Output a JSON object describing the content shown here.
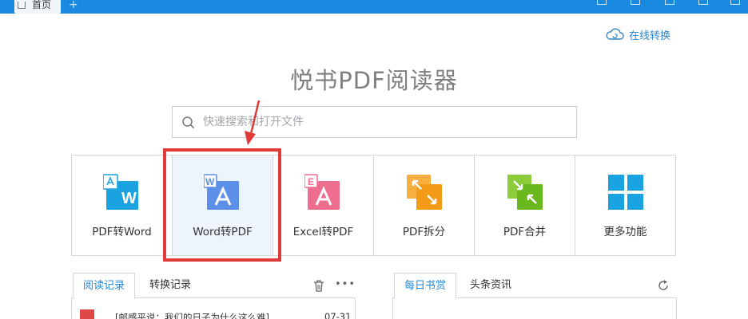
{
  "titlebar": {
    "home_tab_label": "首页",
    "add_tab_symbol": "+"
  },
  "online_convert": {
    "label": "在线转换",
    "icon": "cloud-icon"
  },
  "app_title": "悦书PDF阅读器",
  "search": {
    "placeholder": "快速搜索和打开文件",
    "value": ""
  },
  "tools": [
    {
      "label": "PDF转Word",
      "icon": "pdf-to-word-icon",
      "color": "#1aa3e0"
    },
    {
      "label": "Word转PDF",
      "icon": "word-to-pdf-icon",
      "color": "#5b8fe8"
    },
    {
      "label": "Excel转PDF",
      "icon": "excel-to-pdf-icon",
      "color": "#ee6e8f"
    },
    {
      "label": "PDF拆分",
      "icon": "pdf-split-icon",
      "color": "#f39b16"
    },
    {
      "label": "PDF合并",
      "icon": "pdf-merge-icon",
      "color": "#69b81e"
    },
    {
      "label": "更多功能",
      "icon": "more-functions-icon",
      "color": "#1aa3e0"
    }
  ],
  "left_panel": {
    "tab_reading": "阅读记录",
    "tab_convert": "转换记录",
    "more": "•••",
    "recent_items": [
      {
        "title": "[邮感平说：我们的日子为什么这么难]",
        "date": "07-31"
      }
    ]
  },
  "right_panel": {
    "tab_daily": "每日书赏",
    "tab_news": "头条资讯"
  },
  "colors": {
    "accent": "#1a8ae0",
    "highlight_red": "#e03a38"
  }
}
